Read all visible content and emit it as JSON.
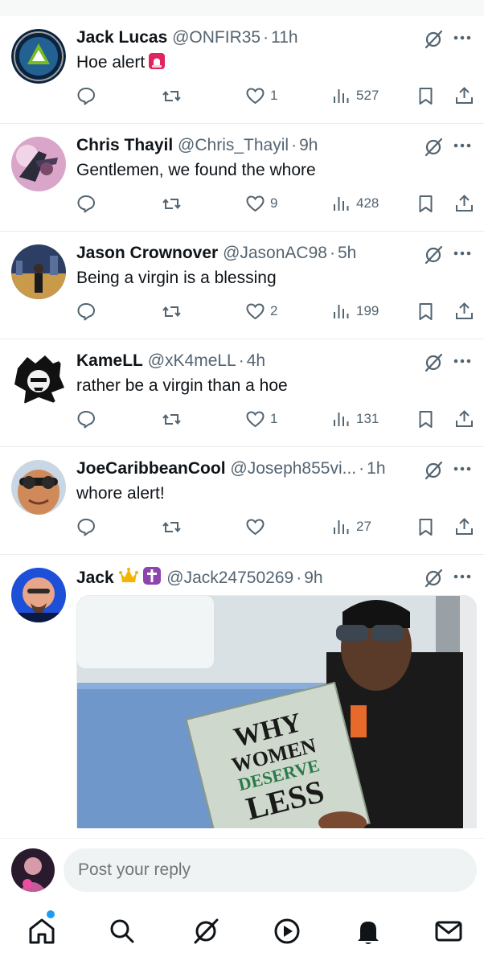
{
  "colors": {
    "accent": "#1d9bf0",
    "secondary_text": "#536471",
    "primary_text": "#0f1419",
    "crown": "#f4b400",
    "cross_badge": "#8e44ad"
  },
  "tweets": [
    {
      "name": "Jack Lucas",
      "handle": "@ONFIR35",
      "time": "11h",
      "text": "Hoe alert",
      "emoji": "police-light",
      "likes": "1",
      "views": "527"
    },
    {
      "name": "Chris Thayil",
      "handle": "@Chris_Thayil",
      "time": "9h",
      "text": "Gentlemen, we found the whore",
      "likes": "9",
      "views": "428"
    },
    {
      "name": "Jason Crownover",
      "handle": "@JasonAC98",
      "time": "5h",
      "text": "Being a virgin is a blessing",
      "likes": "2",
      "views": "199"
    },
    {
      "name": "KameLL",
      "handle": "@xK4meLL",
      "time": "4h",
      "text": "rather be a virgin than a hoe",
      "likes": "1",
      "views": "131"
    },
    {
      "name": "JoeCaribbeanCool",
      "handle": "@Joseph855vi...",
      "time": "1h",
      "text": "whore alert!",
      "likes": "",
      "views": "27"
    },
    {
      "name": "Jack",
      "handle": "@Jack24750269",
      "time": "9h",
      "badges": [
        "crown",
        "cross"
      ],
      "media": {
        "book_lines": [
          "WHY",
          "WOMEN",
          "DESERVE",
          "LESS"
        ]
      }
    }
  ],
  "reply": {
    "placeholder": "Post your reply"
  },
  "nav": {
    "items": [
      "home-icon",
      "search-icon",
      "grok-icon",
      "play-icon",
      "bell-icon",
      "mail-icon"
    ]
  }
}
